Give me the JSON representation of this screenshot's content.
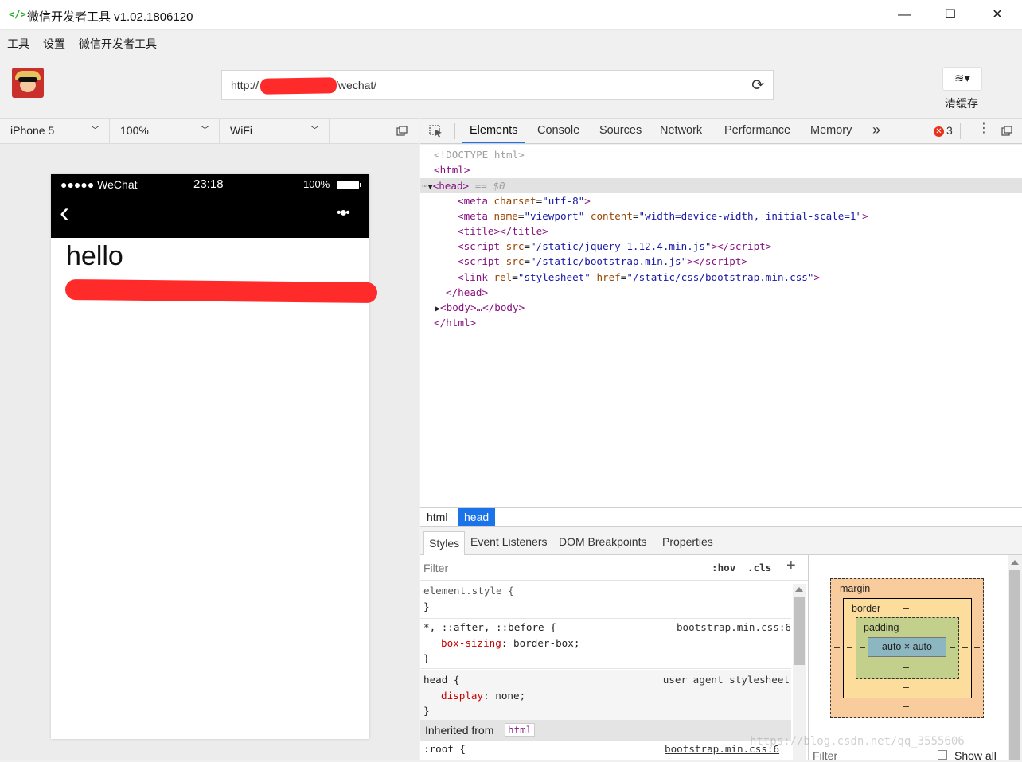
{
  "window": {
    "title": "微信开发者工具 v1.02.1806120",
    "logo_glyph": "</>",
    "minimize": "—",
    "maximize": "☐",
    "close": "✕"
  },
  "menu": [
    "工具",
    "设置",
    "微信开发者工具"
  ],
  "toolbar": {
    "url_prefix": "http://",
    "url_suffix": "/wechat/",
    "reload_glyph": "⟳",
    "cache_icon_glyph": "≋▾",
    "cache_label": "清缓存"
  },
  "simulator": {
    "device": "iPhone 5",
    "zoom": "100%",
    "network": "WiFi",
    "status_left": "●●●●● WeChat",
    "status_time": "23:18",
    "status_battery": "100%",
    "back_glyph": "‹",
    "more_glyph": "•●•",
    "page_heading": "hello"
  },
  "devtools": {
    "tabs": [
      "Elements",
      "Console",
      "Sources",
      "Network",
      "Performance",
      "Memory"
    ],
    "active_tab": "Elements",
    "more_tabs_glyph": "»",
    "error_count": "3",
    "dom": {
      "doctype": "<!DOCTYPE html>",
      "html_open": "<html>",
      "head_open": "<head>",
      "head_marker": "== $0",
      "meta_charset_attr": "charset",
      "meta_charset_val": "\"utf-8\"",
      "meta_viewport_name_attr": "name",
      "meta_viewport_name_val": "\"viewport\"",
      "meta_viewport_content_attr": "content",
      "meta_viewport_content_val": "\"width=device-width, initial-scale=1\"",
      "title_line": "<title></title>",
      "script1_src": "/static/jquery-1.12.4.min.js",
      "script2_src": "/static/bootstrap.min.js",
      "link_rel_val": "\"stylesheet\"",
      "link_href": "/static/css/bootstrap.min.css",
      "head_close": "</head>",
      "body_collapsed": "<body>…</body>",
      "html_close": "</html>"
    },
    "breadcrumbs": [
      "html",
      "head"
    ],
    "subtabs": [
      "Styles",
      "Event Listeners",
      "DOM Breakpoints",
      "Properties"
    ],
    "styles": {
      "filter_placeholder": "Filter",
      "hov": ":hov",
      "cls": ".cls",
      "add": "+",
      "rules": [
        {
          "selector": "element.style {",
          "source": "",
          "decls": [],
          "close": "}"
        },
        {
          "selector": "*, ::after, ::before {",
          "source": "bootstrap.min.css:6",
          "decls": [
            {
              "prop": "box-sizing",
              "value": "border-box;"
            }
          ],
          "close": "}"
        },
        {
          "selector": "head {",
          "source": "user agent stylesheet",
          "decls": [
            {
              "prop": "display",
              "value": "none;"
            }
          ],
          "close": "}"
        }
      ],
      "inherited_label": "Inherited from",
      "inherited_tag": "html",
      "root_selector": ":root {",
      "root_source": "bootstrap.min.css:6"
    },
    "box_model": {
      "margin": "margin",
      "border": "border",
      "padding": "padding",
      "content": "auto × auto",
      "dash": "–",
      "filter": "Filter",
      "show_all": "Show all",
      "colors": {
        "margin": "#f9cc9d",
        "border": "#fddd9b",
        "padding": "#c3d08b",
        "content": "#8cb6c0"
      }
    }
  },
  "watermark": "https://blog.csdn.net/qq_3555606"
}
